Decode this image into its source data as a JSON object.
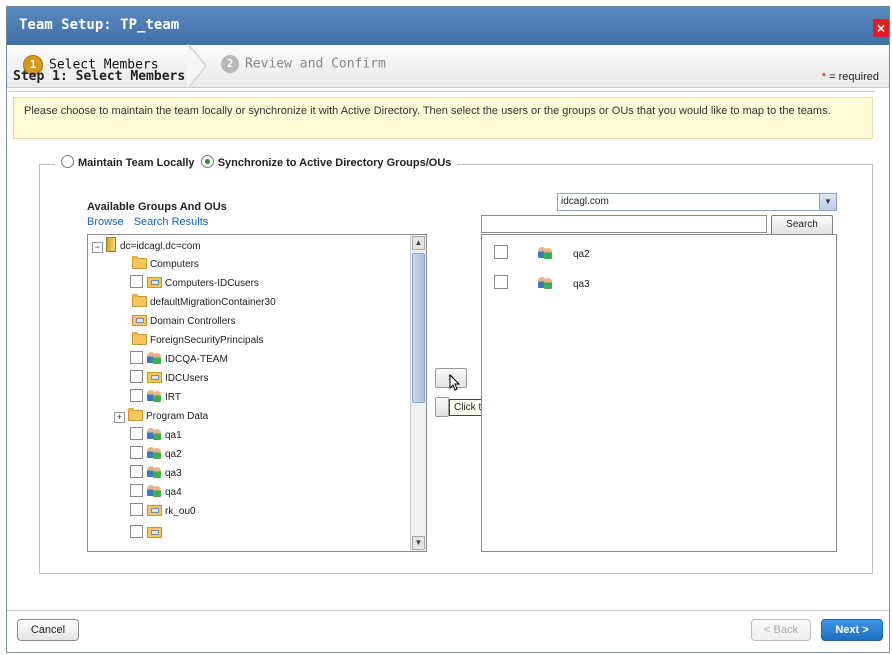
{
  "dialog": {
    "title": "Team Setup: TP_team",
    "close_label": "×"
  },
  "wizard": {
    "steps": [
      {
        "number": "1",
        "label": "Select Members"
      },
      {
        "number": "2",
        "label": "Review and Confirm"
      }
    ]
  },
  "main": {
    "heading": "Step 1: Select Members",
    "required_star": "*",
    "required_text": " = required",
    "info": "Please choose to maintain the team locally or synchronize it with Active Directory. Then select the users or the groups or OUs that you would like to map to the teams.",
    "mode": {
      "option_local": "Maintain Team Locally",
      "option_sync": "Synchronize to Active Directory Groups/OUs",
      "selected": "sync"
    }
  },
  "available": {
    "label": "Available Groups And OUs",
    "link_browse": "Browse",
    "link_search": "Search Results",
    "tree": [
      "dc=idcagl,dc=com",
      "Computers",
      "Computers-IDCusers",
      "defaultMigrationContainer30",
      "Domain Controllers",
      "ForeignSecurityPrincipals",
      "IDCQA-TEAM",
      "IDCUsers",
      "IRT",
      "Program Data",
      "qa1",
      "qa2",
      "qa3",
      "qa4",
      "rk_ou0"
    ]
  },
  "transfer": {
    "add_label": "»",
    "tooltip": "Click to add selection"
  },
  "search": {
    "domain": "idcagl.com",
    "input_value": "",
    "button": "Search",
    "results": [
      "qa2",
      "qa3"
    ]
  },
  "footer": {
    "cancel": "Cancel",
    "back": "< Back",
    "next": "Next >"
  },
  "colors": {
    "title_bar": "#4a7db5",
    "info_bg": "#fffbd6",
    "next_button": "#2a7fd4",
    "step_active": "#d89a1c"
  }
}
